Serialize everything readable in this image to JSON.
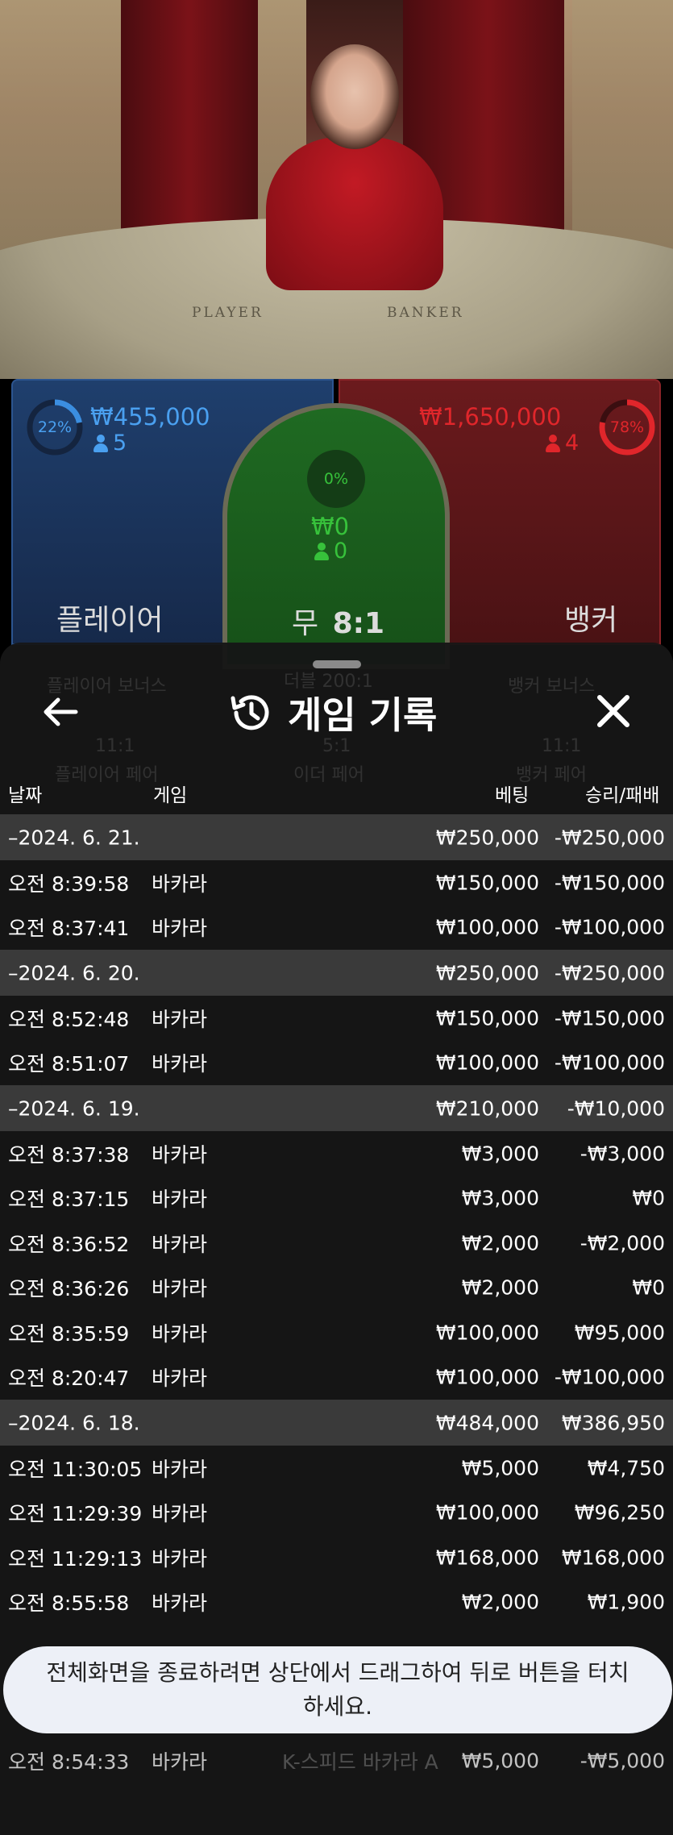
{
  "video": {
    "felt_player": "PLAYER",
    "felt_banker": "BANKER"
  },
  "bets": {
    "player": {
      "percent": "22%",
      "amount": "₩455,000",
      "count": "5",
      "label": "플레이어",
      "share": 0.22,
      "color": "#3b8ee0"
    },
    "tie": {
      "percent": "0%",
      "amount": "₩0",
      "count": "0",
      "label_prefix": "무",
      "label_odds": "8:1",
      "share": 0.0,
      "color": "#37c23b"
    },
    "banker": {
      "percent": "78%",
      "amount": "₩1,650,000",
      "count": "4",
      "label": "뱅커",
      "share": 0.78,
      "color": "#e0262b"
    }
  },
  "history": {
    "title": "게임 기록",
    "back_icon": "arrow-left-icon",
    "history_icon": "history-clock-icon",
    "close_icon": "close-icon",
    "ghost_tabs": [
      "플레이어 보너스",
      "더블 200:1",
      "뱅커 보너스"
    ],
    "ghost_odds": [
      "11:1",
      "5:1",
      "11:1"
    ],
    "ghost_subs": [
      "플레이어 페어",
      "이더 페어",
      "뱅커 페어"
    ],
    "columns": {
      "date": "날짜",
      "game": "게임",
      "bet": "베팅",
      "result": "승리/패배"
    },
    "rows": [
      {
        "type": "group",
        "date": "–2024. 6. 21.",
        "game": "",
        "bet": "₩250,000",
        "result": "-₩250,000"
      },
      {
        "type": "item",
        "date": "오전 8:39:58",
        "game": "바카라",
        "bet": "₩150,000",
        "result": "-₩150,000"
      },
      {
        "type": "item",
        "date": "오전 8:37:41",
        "game": "바카라",
        "bet": "₩100,000",
        "result": "-₩100,000"
      },
      {
        "type": "group",
        "date": "–2024. 6. 20.",
        "game": "",
        "bet": "₩250,000",
        "result": "-₩250,000"
      },
      {
        "type": "item",
        "date": "오전 8:52:48",
        "game": "바카라",
        "bet": "₩150,000",
        "result": "-₩150,000"
      },
      {
        "type": "item",
        "date": "오전 8:51:07",
        "game": "바카라",
        "bet": "₩100,000",
        "result": "-₩100,000"
      },
      {
        "type": "group",
        "date": "–2024. 6. 19.",
        "game": "",
        "bet": "₩210,000",
        "result": "-₩10,000"
      },
      {
        "type": "item",
        "date": "오전 8:37:38",
        "game": "바카라",
        "bet": "₩3,000",
        "result": "-₩3,000"
      },
      {
        "type": "item",
        "date": "오전 8:37:15",
        "game": "바카라",
        "bet": "₩3,000",
        "result": "₩0"
      },
      {
        "type": "item",
        "date": "오전 8:36:52",
        "game": "바카라",
        "bet": "₩2,000",
        "result": "-₩2,000"
      },
      {
        "type": "item",
        "date": "오전 8:36:26",
        "game": "바카라",
        "bet": "₩2,000",
        "result": "₩0"
      },
      {
        "type": "item",
        "date": "오전 8:35:59",
        "game": "바카라",
        "bet": "₩100,000",
        "result": "₩95,000"
      },
      {
        "type": "item",
        "date": "오전 8:20:47",
        "game": "바카라",
        "bet": "₩100,000",
        "result": "-₩100,000"
      },
      {
        "type": "group",
        "date": "–2024. 6. 18.",
        "game": "",
        "bet": "₩484,000",
        "result": "₩386,950"
      },
      {
        "type": "item",
        "date": "오전 11:30:05",
        "game": "바카라",
        "bet": "₩5,000",
        "result": "₩4,750"
      },
      {
        "type": "item",
        "date": "오전 11:29:39",
        "game": "바카라",
        "bet": "₩100,000",
        "result": "₩96,250"
      },
      {
        "type": "item",
        "date": "오전 11:29:13",
        "game": "바카라",
        "bet": "₩168,000",
        "result": "₩168,000"
      },
      {
        "type": "item",
        "date": "오전 8:55:58",
        "game": "바카라",
        "bet": "₩2,000",
        "result": "₩1,900"
      }
    ],
    "under_toast_row": {
      "date": "오전 8:54:33",
      "game": "바카라",
      "overlay": "K-스피드 바카라 A",
      "bet": "₩5,000",
      "result": "-₩5,000"
    }
  },
  "toast": {
    "message": "전체화면을 종료하려면 상단에서 드래그하여 뒤로 버튼을 터치하세요."
  }
}
